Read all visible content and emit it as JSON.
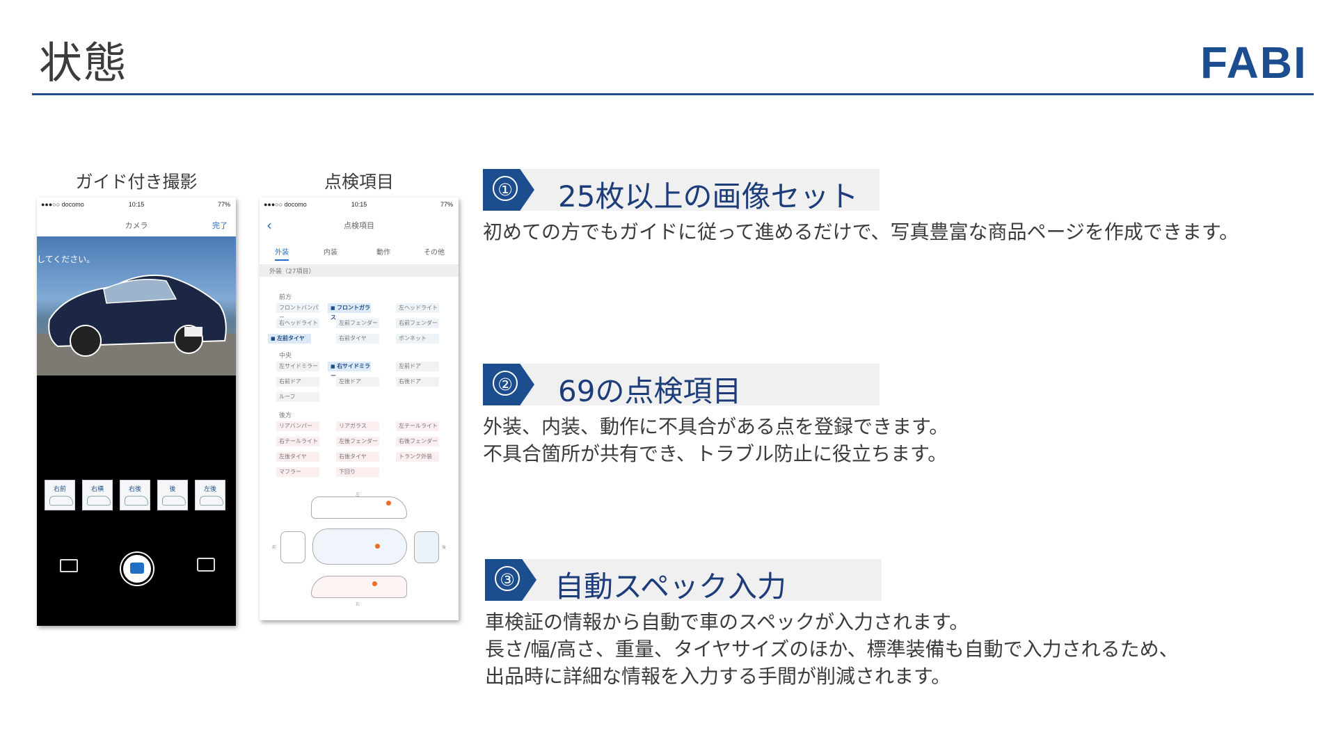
{
  "slide": {
    "title": "状態"
  },
  "logo": {
    "text": "FABI",
    "color": "#1c4d8e"
  },
  "phones": {
    "guide": {
      "caption": "ガイド付き撮影",
      "status": {
        "carrier": "●●●○○ docomo",
        "time": "10:15",
        "battery": "77%"
      },
      "nav": {
        "title": "カメラ",
        "done": "完了"
      },
      "hint": "してください。",
      "thumbs": [
        "右前",
        "右横",
        "右後",
        "後",
        "左後"
      ]
    },
    "inspection": {
      "caption": "点検項目",
      "status": {
        "carrier": "●●●○○ docomo",
        "time": "10:15",
        "battery": "77%"
      },
      "nav": {
        "title": "点検項目",
        "back": "‹"
      },
      "tabs": [
        "外装",
        "内装",
        "動作",
        "その他"
      ],
      "section": "外装（27項目）",
      "groups": {
        "front": {
          "label": "前方",
          "items": [
            "フロントバンパー",
            "フロントガラス",
            "左ヘッドライト",
            "右ヘッドライト",
            "左前フェンダー",
            "右前フェンダー",
            "左前タイヤ",
            "右前タイヤ",
            "ボンネット"
          ]
        },
        "center": {
          "label": "中央",
          "items": [
            "左サイドミラー",
            "右サイドミラー",
            "左前ドア",
            "右前ドア",
            "左後ドア",
            "右後ドア",
            "ルーフ"
          ]
        },
        "rear": {
          "label": "後方",
          "items": [
            "リアバンパー",
            "リアガラス",
            "左テールライト",
            "右テールライト",
            "左後フェンダー",
            "右後フェンダー",
            "左後タイヤ",
            "右後タイヤ",
            "トランク外装",
            "マフラー",
            "下回り"
          ]
        }
      },
      "diagram_labels": {
        "top": "左",
        "bottom": "右",
        "left": "前",
        "right": "後"
      }
    }
  },
  "features": [
    {
      "num": "①",
      "title": "25枚以上の画像セット",
      "desc": [
        "初めての方でもガイドに従って進めるだけで、写真豊富な商品ページを作成できます。"
      ]
    },
    {
      "num": "②",
      "title": "69の点検項目",
      "desc": [
        "外装、内装、動作に不具合がある点を登録できます。",
        "不具合箇所が共有でき、トラブル防止に役立ちます。"
      ]
    },
    {
      "num": "③",
      "title": "自動スペック入力",
      "desc": [
        "車検証の情報から自動で車のスペックが入力されます。",
        "長さ/幅/高さ、重量、タイヤサイズのほか、標準装備も自動で入力されるため、",
        "出品時に詳細な情報を入力する手間が削減されます。"
      ]
    }
  ]
}
